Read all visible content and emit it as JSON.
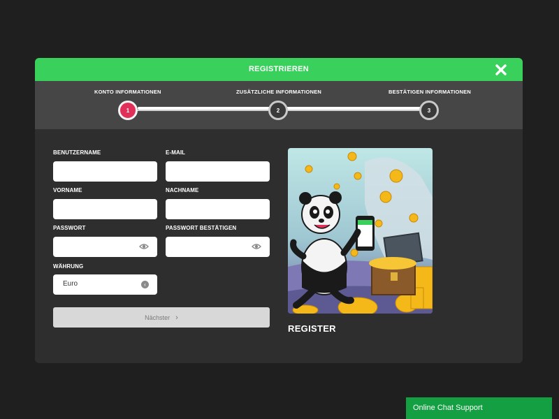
{
  "modal": {
    "title": "REGISTRIEREN",
    "close_icon": "close-icon"
  },
  "steps": [
    {
      "number": "1",
      "label": "KONTO INFORMATIONEN",
      "active": true
    },
    {
      "number": "2",
      "label": "ZUSÄTZLICHE INFORMATIONEN",
      "active": false
    },
    {
      "number": "3",
      "label": "BESTÄTIGEN INFORMATIONEN",
      "active": false
    }
  ],
  "form": {
    "username_label": "BENUTZERNAME",
    "username_value": "",
    "email_label": "E-MAIL",
    "email_value": "",
    "firstname_label": "VORNAME",
    "firstname_value": "",
    "lastname_label": "NACHNAME",
    "lastname_value": "",
    "password_label": "PASSWORT",
    "password_value": "",
    "password_confirm_label": "PASSWORT BESTÄTIGEN",
    "password_confirm_value": "",
    "currency_label": "WÄHRUNG",
    "currency_value": "Euro",
    "next_label": "Nächster"
  },
  "promo": {
    "caption": "REGISTER"
  },
  "chat": {
    "label": "Online Chat Support"
  },
  "colors": {
    "accent_green": "#39d05c",
    "active_step": "#e0305a",
    "chat_green": "#14a042"
  }
}
